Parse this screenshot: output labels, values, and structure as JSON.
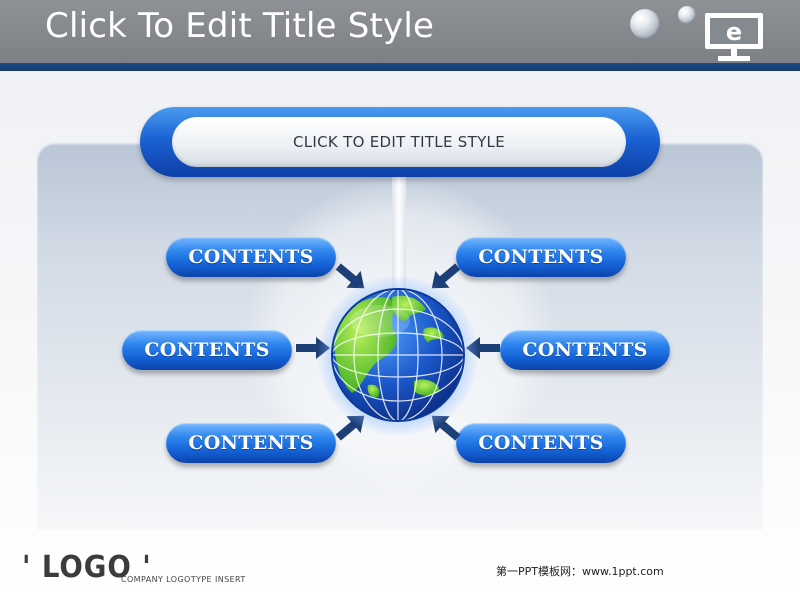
{
  "header": {
    "title": "Click To Edit Title Style",
    "icons": [
      "bubble-icon",
      "bubble-icon",
      "monitor-e-icon"
    ],
    "monitor_letter": "e"
  },
  "diagram": {
    "center_title": "CLICK TO EDIT TITLE STYLE",
    "center_icon": "globe-icon",
    "contents": [
      {
        "label": "CONTENTS",
        "position": "top-left"
      },
      {
        "label": "CONTENTS",
        "position": "top-right"
      },
      {
        "label": "CONTENTS",
        "position": "middle-left"
      },
      {
        "label": "CONTENTS",
        "position": "middle-right"
      },
      {
        "label": "CONTENTS",
        "position": "bottom-left"
      },
      {
        "label": "CONTENTS",
        "position": "bottom-right"
      }
    ]
  },
  "footer": {
    "logo": "' LOGO '",
    "logo_subtitle": "COMPANY LOGOTYPE INSERT",
    "credit": "第一PPT模板网：www.1ppt.com"
  },
  "colors": {
    "header_bg": "#858990",
    "stripe": "#1c4580",
    "pill_blue": "#1b62d4",
    "arrow": "#1d3f78",
    "globe_ocean": "#1a56c8",
    "globe_land": "#7fd43a"
  }
}
